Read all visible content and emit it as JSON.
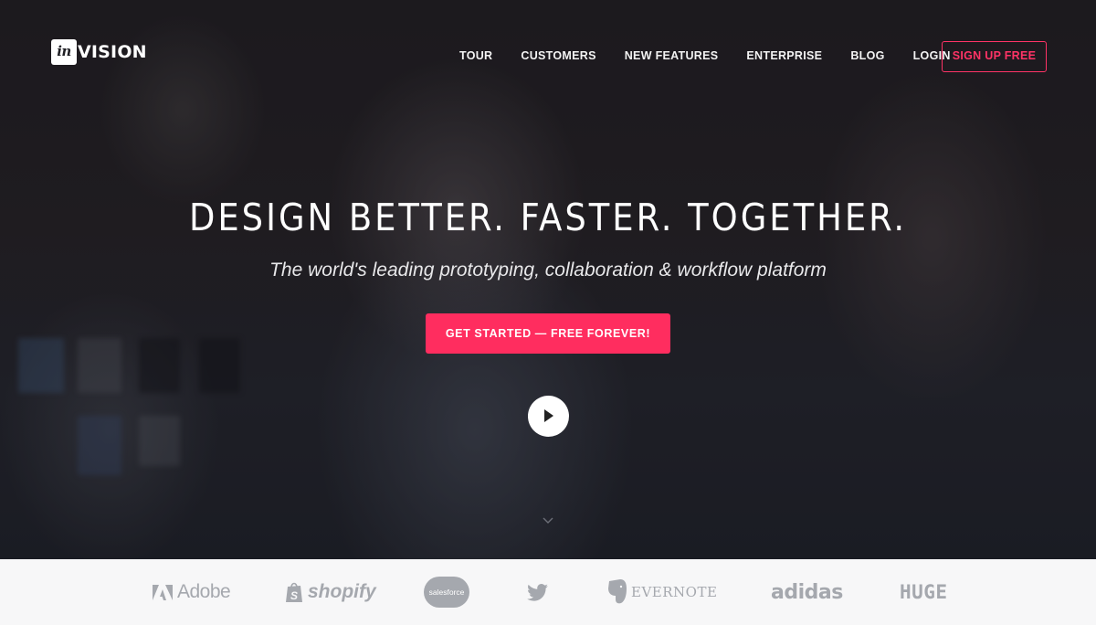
{
  "brand": {
    "logo_mark": "in",
    "logo_text": "VISION"
  },
  "nav": {
    "links": [
      {
        "label": "TOUR"
      },
      {
        "label": "CUSTOMERS"
      },
      {
        "label": "NEW FEATURES"
      },
      {
        "label": "ENTERPRISE"
      },
      {
        "label": "BLOG"
      },
      {
        "label": "LOGIN"
      }
    ],
    "signup_label": "SIGN UP FREE"
  },
  "hero": {
    "headline": "DESIGN BETTER. FASTER. TOGETHER.",
    "subheadline": "The world's leading prototyping, collaboration & workflow platform",
    "cta_label": "GET STARTED — FREE FOREVER!",
    "play_icon": "play-icon",
    "scroll_icon": "chevron-down-icon"
  },
  "customers": {
    "logos": [
      {
        "name": "Adobe",
        "icon": "adobe-logo-icon"
      },
      {
        "name": "shopify",
        "icon": "shopify-bag-icon"
      },
      {
        "name": "salesforce",
        "icon": "salesforce-cloud-icon"
      },
      {
        "name": "Twitter",
        "icon": "twitter-bird-icon"
      },
      {
        "name": "EVERNOTE",
        "icon": "evernote-elephant-icon"
      },
      {
        "name": "adidas",
        "icon": "adidas-logo-icon"
      },
      {
        "name": "HUGE",
        "icon": "huge-logo-icon"
      }
    ]
  },
  "colors": {
    "accent": "#ff2d5f",
    "signup_border": "#ff3366",
    "logo_gray": "#a5a8ae",
    "strip_bg": "#f7f7f8"
  }
}
